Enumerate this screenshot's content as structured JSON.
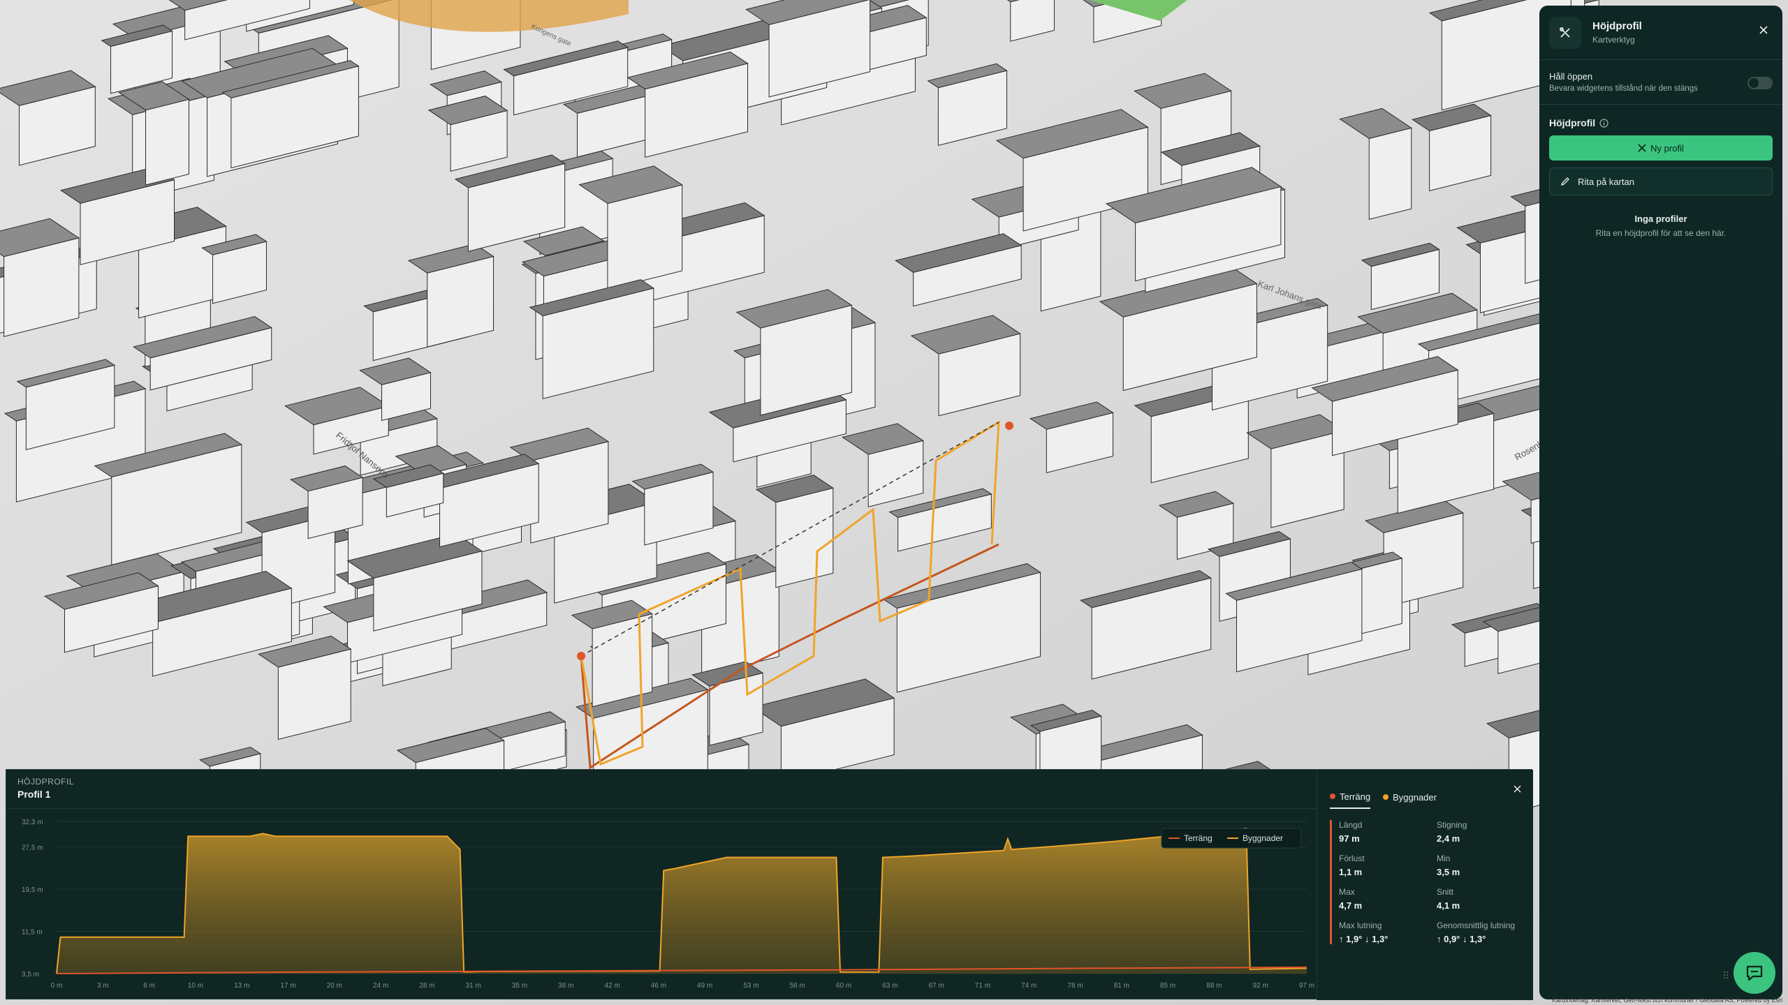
{
  "widget": {
    "title": "Höjdprofil",
    "subtitle": "Kartverktyg",
    "keep_open_label": "Håll öppen",
    "keep_open_desc": "Bevara widgetens tillstånd när den stängs",
    "keep_open_on": false,
    "section_title": "Höjdprofil",
    "new_profile_label": "Ny profil",
    "draw_label": "Rita på kartan",
    "empty_title": "Inga profiler",
    "empty_desc": "Rita en höjdprofil för att se den här."
  },
  "map": {
    "street_labels": [
      "Kongens gate",
      "Karl Johans gate",
      "Fridtjof Nansens",
      "Rosenkrantz"
    ],
    "attribution": "Kartunderlag: Kartverket, Geo-tekst och kommuner / Geodata AS, Powered by Esri"
  },
  "profile": {
    "kicker": "HÖJDPROFIL",
    "name": "Profil 1",
    "tabs": [
      {
        "label": "Terräng",
        "color": "#e2542a",
        "active": true
      },
      {
        "label": "Byggnader",
        "color": "#f0a429",
        "active": false
      }
    ],
    "stats": [
      {
        "label": "Längd",
        "value": "97 m"
      },
      {
        "label": "Stigning",
        "value": "2,4 m"
      },
      {
        "label": "Förlust",
        "value": "1,1 m"
      },
      {
        "label": "Min",
        "value": "3,5 m"
      },
      {
        "label": "Max",
        "value": "4,7 m"
      },
      {
        "label": "Snitt",
        "value": "4,1 m"
      },
      {
        "label": "Max lutning",
        "value": "↑ 1,9° ↓ 1,3°"
      },
      {
        "label": "Genomsnittlig lutning",
        "value": "↑ 0,9° ↓ 1,3°"
      }
    ]
  },
  "chart_data": {
    "type": "area",
    "xlabel": "",
    "ylabel": "",
    "y_ticks": [
      "32,3 m",
      "27,5 m",
      "19,5 m",
      "11,5 m",
      "3,5 m"
    ],
    "x_ticks": [
      "0 m",
      "3 m",
      "6 m",
      "10 m",
      "13 m",
      "17 m",
      "20 m",
      "24 m",
      "28 m",
      "31 m",
      "35 m",
      "38 m",
      "42 m",
      "46 m",
      "49 m",
      "53 m",
      "56 m",
      "60 m",
      "63 m",
      "67 m",
      "71 m",
      "74 m",
      "78 m",
      "81 m",
      "85 m",
      "88 m",
      "92 m",
      "97 m"
    ],
    "ylim": [
      3.5,
      32.3
    ],
    "xlim": [
      0,
      97
    ],
    "legend": "top-right",
    "series": [
      {
        "name": "Terräng",
        "color": "#e2542a",
        "x": [
          0,
          20,
          40,
          60,
          80,
          97
        ],
        "y": [
          3.5,
          3.8,
          4.0,
          4.2,
          4.5,
          4.7
        ]
      },
      {
        "name": "Byggnader",
        "color": "#f0a429",
        "x": [
          0,
          0.3,
          9.9,
          10.2,
          15,
          16,
          17,
          30.3,
          31.3,
          31.6,
          33,
          46.8,
          47.1,
          48,
          52,
          60.5,
          60.8,
          63.8,
          64.1,
          66,
          73.5,
          73.8,
          74.1,
          77,
          82,
          92.3,
          92.6,
          97
        ],
        "y": [
          3.5,
          10.4,
          10.4,
          29.5,
          29.5,
          30.0,
          29.5,
          29.5,
          27.0,
          3.8,
          3.9,
          4.0,
          23.0,
          23.4,
          25.5,
          25.5,
          3.8,
          3.8,
          25.5,
          25.7,
          26.8,
          29.0,
          27.0,
          27.5,
          28.5,
          31.0,
          4.3,
          4.5
        ]
      }
    ]
  }
}
